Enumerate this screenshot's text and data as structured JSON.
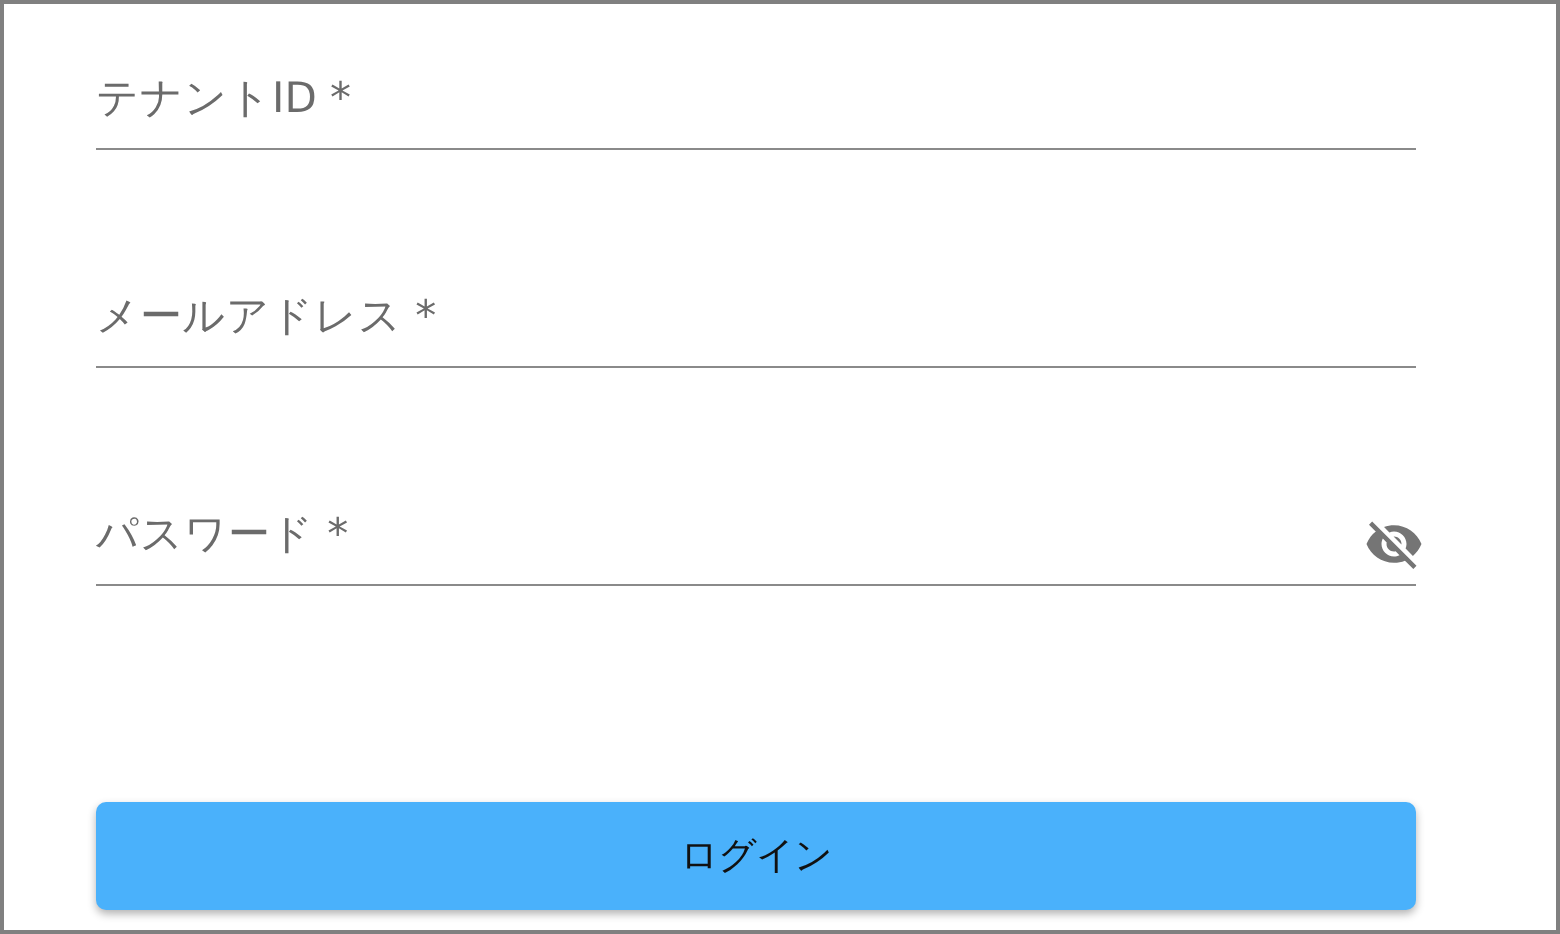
{
  "fields": [
    {
      "placeholder": "テナントID *",
      "kind": "text"
    },
    {
      "placeholder": "メールアドレス *",
      "kind": "text"
    },
    {
      "placeholder": "パスワード *",
      "kind": "password",
      "password_visible": false
    }
  ],
  "login_button": {
    "label": "ログイン"
  }
}
